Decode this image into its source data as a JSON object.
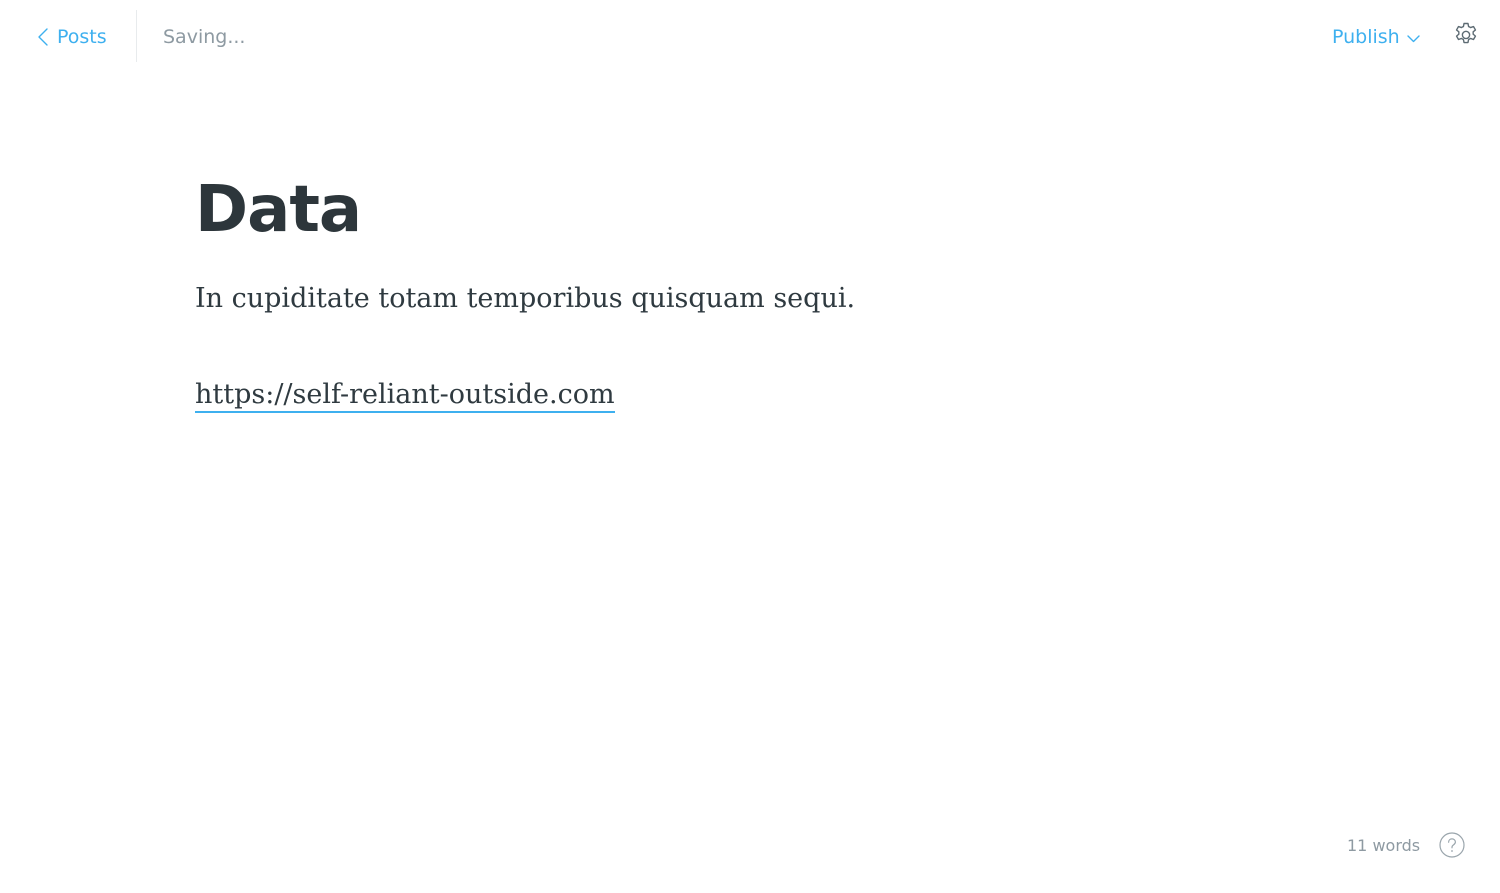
{
  "header": {
    "back_label": "Posts",
    "save_status": "Saving...",
    "publish_label": "Publish",
    "icons": {
      "back": "chevron-left-icon",
      "publish_dropdown": "chevron-down-icon",
      "settings": "gear-icon"
    }
  },
  "editor": {
    "title": "Data",
    "paragraphs": [
      "In cupiditate totam temporibus quisquam sequi."
    ],
    "link_text": "https://self-reliant-outside.com"
  },
  "footer": {
    "word_count": "11 words",
    "help_icon": "help-circle-icon"
  },
  "colors": {
    "accent": "#3eb0ef",
    "muted_text": "#8e9aa2",
    "heading_text": "#2d363b",
    "body_text": "#2f3a40"
  }
}
